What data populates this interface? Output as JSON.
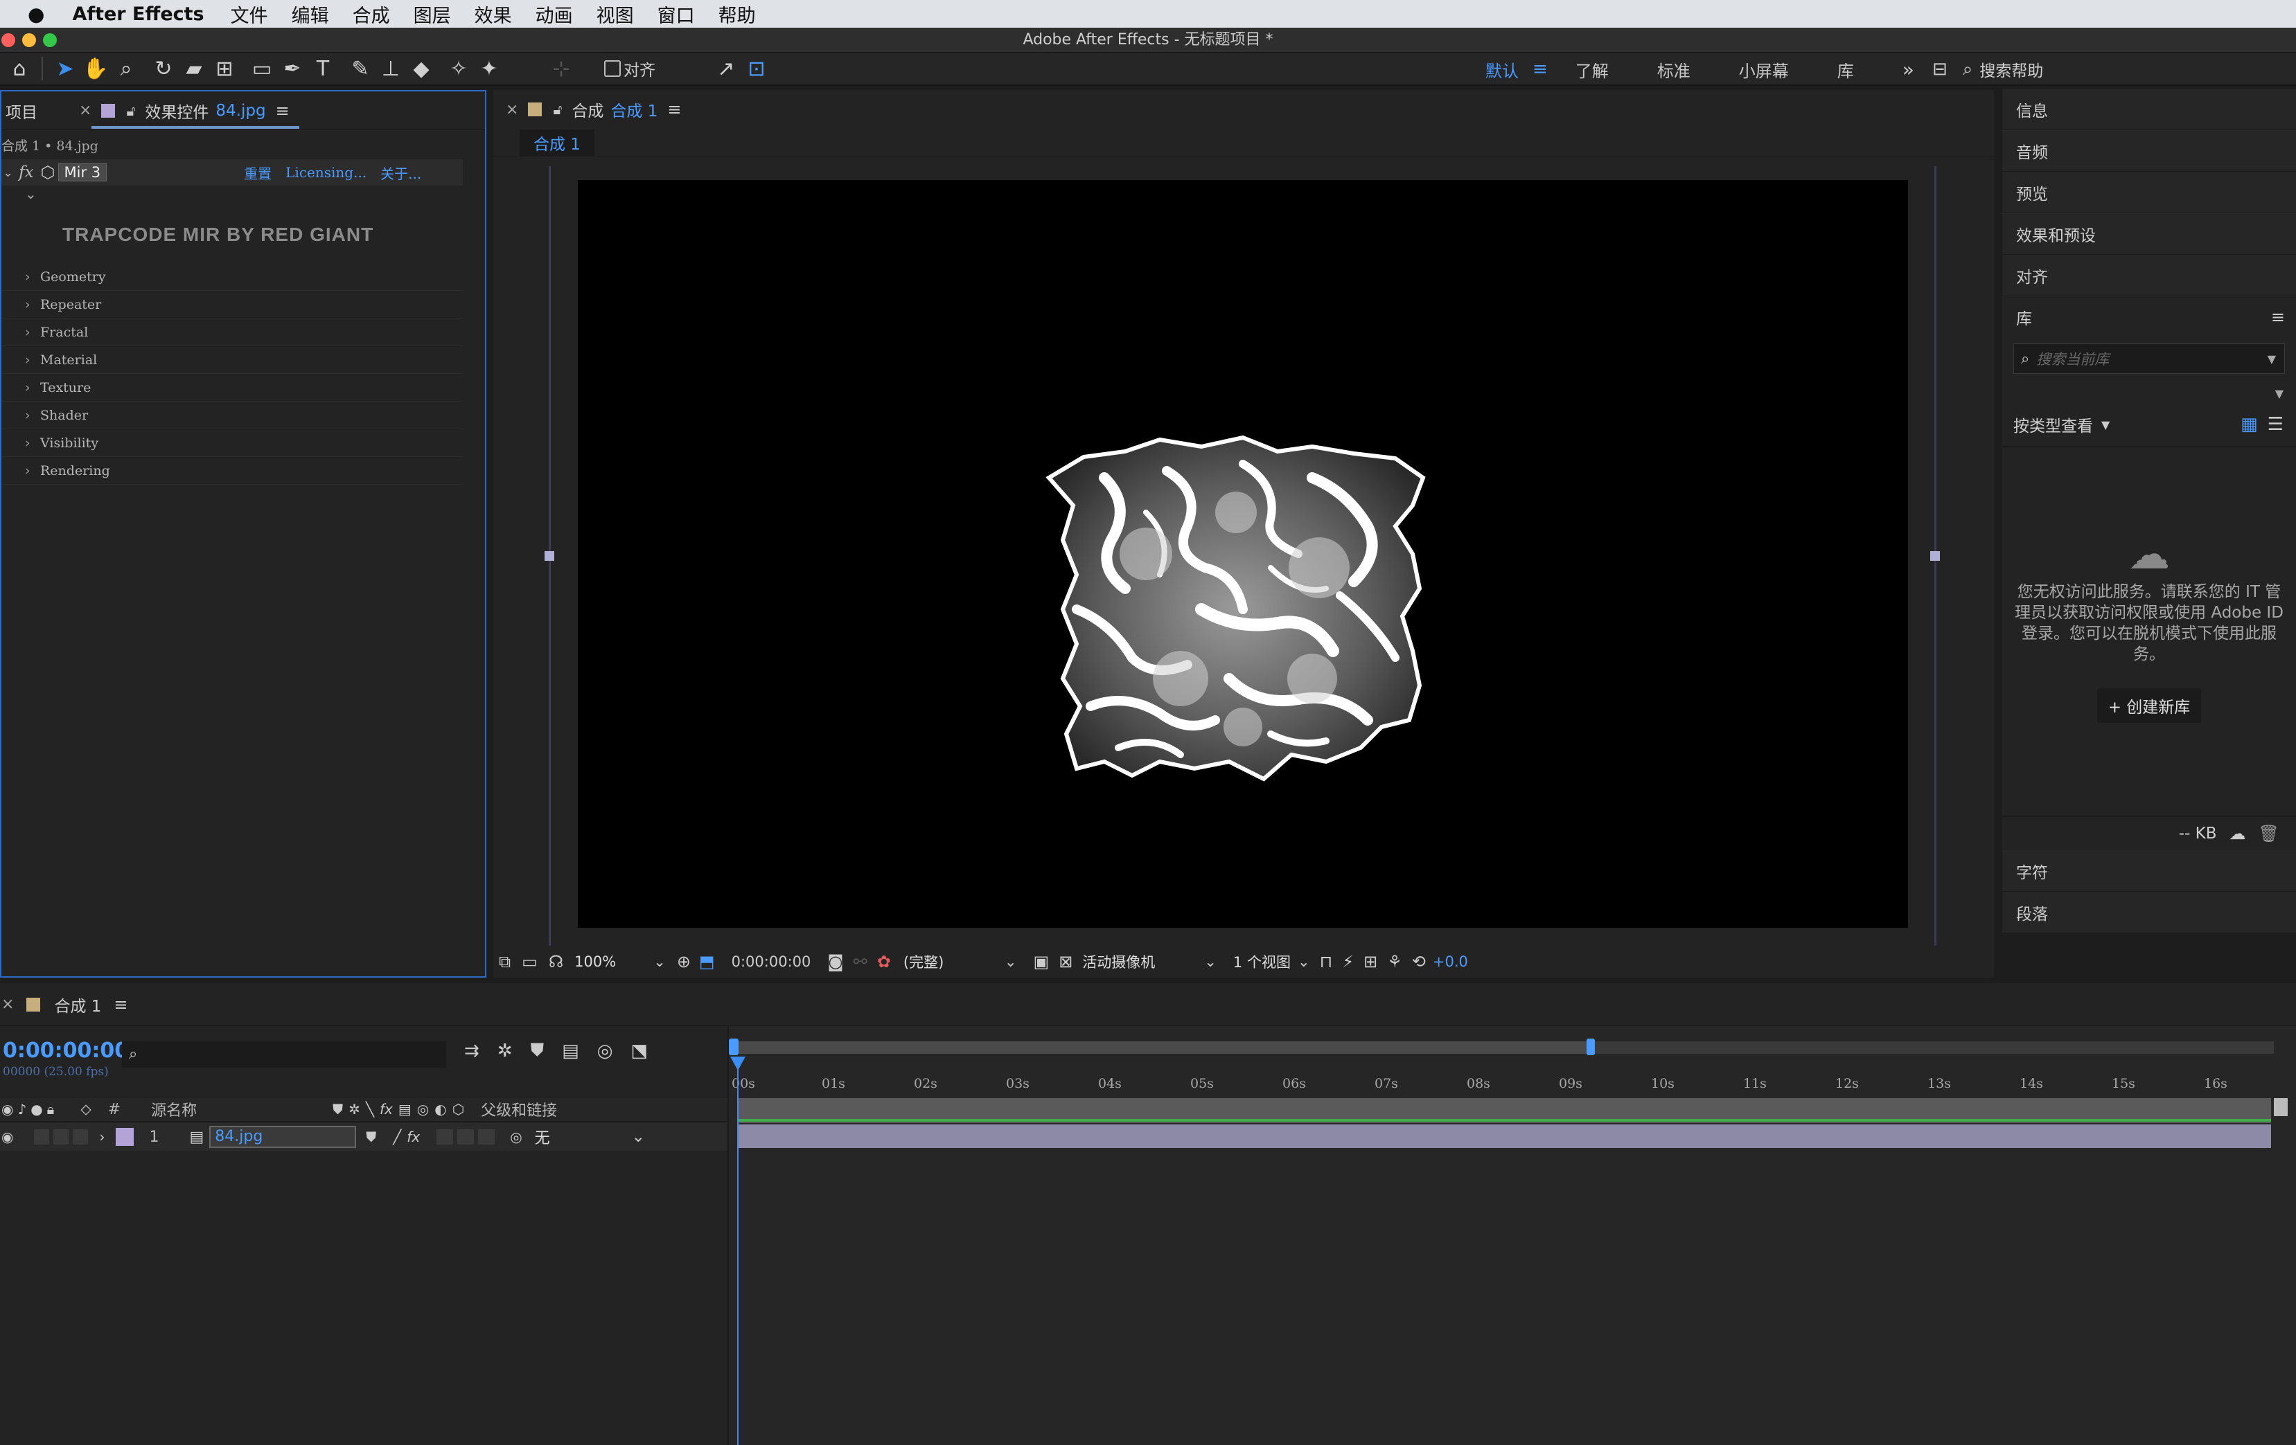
{
  "menubar": {
    "app_name": "After Effects",
    "items": [
      "文件",
      "编辑",
      "合成",
      "图层",
      "效果",
      "动画",
      "视图",
      "窗口",
      "帮助"
    ]
  },
  "window": {
    "title": "Adobe After Effects - 无标题项目 *"
  },
  "toolbar": {
    "align_label": "对齐",
    "workspaces": [
      "默认",
      "了解",
      "标准",
      "小屏幕",
      "库"
    ],
    "search_help": "搜索帮助"
  },
  "effects_panel": {
    "tab_project": "项目",
    "tab_effects": "效果控件",
    "tab_effects_file": "84.jpg",
    "breadcrumb": "合成 1 • 84.jpg",
    "effect_name": "Mir 3",
    "reset": "重置",
    "licensing": "Licensing...",
    "about": "关于...",
    "brand": "TRAPCODE MIR BY RED GIANT",
    "groups": [
      "Geometry",
      "Repeater",
      "Fractal",
      "Material",
      "Texture",
      "Shader",
      "Visibility",
      "Rendering"
    ]
  },
  "viewer": {
    "tab_prefix": "合成",
    "tab_name": "合成 1",
    "sub_tab": "合成 1",
    "zoom": "100%",
    "timecode": "0:00:00:00",
    "resolution": "(完整)",
    "camera": "活动摄像机",
    "views": "1 个视图",
    "exposure": "+0.0"
  },
  "right_panel": {
    "items_top": [
      "信息",
      "音频",
      "预览",
      "效果和预设",
      "对齐"
    ],
    "library_title": "库",
    "search_placeholder": "搜索当前库",
    "view_by_type": "按类型查看",
    "no_access_message": "您无权访问此服务。请联系您的 IT 管理员以获取访问权限或使用 Adobe ID 登录。您可以在脱机模式下使用此服务。",
    "create_library": "+ 创建新库",
    "storage": "-- KB",
    "items_bottom": [
      "字符",
      "段落"
    ]
  },
  "timeline": {
    "tab_name": "合成 1",
    "timecode": "0:00:00:00",
    "frame_info": "00000 (25.00 fps)",
    "col_number": "#",
    "col_source_name": "源名称",
    "col_parent": "父级和链接",
    "layer_number": "1",
    "layer_name": "84.jpg",
    "parent_value": "无",
    "ruler": [
      "00s",
      "01s",
      "02s",
      "03s",
      "04s",
      "05s",
      "06s",
      "07s",
      "08s",
      "09s",
      "10s",
      "11s",
      "12s",
      "13s",
      "14s",
      "15s",
      "16s"
    ]
  },
  "colors": {
    "accent": "#4b9bff",
    "panel_bg": "#232323",
    "active_border": "#2e6ac4",
    "layer_bar": "#8c8aa6",
    "label_swatch": "#b3a3d6"
  }
}
